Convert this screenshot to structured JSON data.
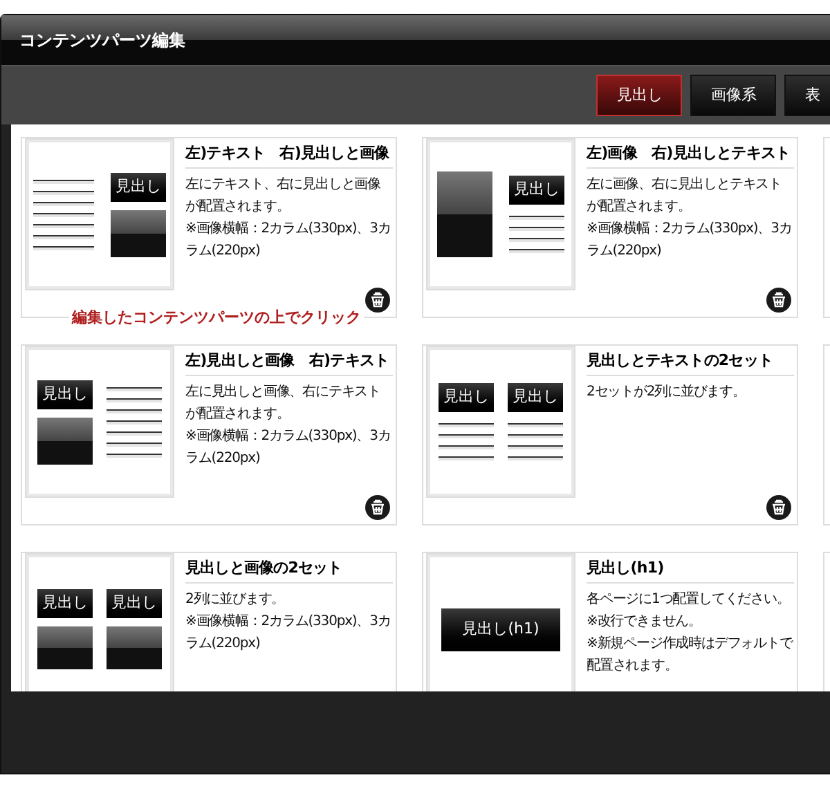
{
  "window": {
    "title": "コンテンツパーツ編集"
  },
  "tabs": [
    {
      "label": "見出し",
      "selected": true
    },
    {
      "label": "画像系",
      "selected": false
    },
    {
      "label": "表",
      "selected": false
    }
  ],
  "hint": "編集したコンテンツパーツの上でクリック",
  "cards": [
    {
      "kind": "text-heading-image",
      "labels": [
        "見出し"
      ],
      "title": "左)テキスト　右)見出しと画像",
      "description": [
        "左にテキスト、右に見出しと画像が配置されます。",
        "※画像横幅：2カラム(330px)、3カラム(220px)"
      ],
      "delete_icon": true
    },
    {
      "kind": "image-heading-text",
      "labels": [
        "見出し"
      ],
      "title": "左)画像　右)見出しとテキスト",
      "description": [
        "左に画像、右に見出しとテキストが配置されます。",
        "※画像横幅：2カラム(330px)、3カラム(220px)"
      ],
      "delete_icon": true
    },
    {
      "kind": "edge"
    },
    {
      "kind": "heading-image-text",
      "labels": [
        "見出し"
      ],
      "title": "左)見出しと画像　右)テキスト",
      "description": [
        "左に見出しと画像、右にテキストが配置されます。",
        "※画像横幅：2カラム(330px)、3カラム(220px)"
      ],
      "delete_icon": true
    },
    {
      "kind": "heading-text-pair",
      "labels": [
        "見出し",
        "見出し"
      ],
      "title": "見出しとテキストの2セット",
      "description": [
        "2セットが2列に並びます。"
      ],
      "delete_icon": true
    },
    {
      "kind": "edge"
    },
    {
      "kind": "heading-image-pair",
      "labels": [
        "見出し",
        "見出し"
      ],
      "title": "見出しと画像の2セット",
      "description": [
        "2列に並びます。",
        "※画像横幅：2カラム(330px)、3カラム(220px)"
      ],
      "delete_icon": false
    },
    {
      "kind": "heading-h1",
      "labels": [
        "見出し(h1)"
      ],
      "title": "見出し(h1)",
      "description": [
        "各ページに1つ配置してください。",
        "※改行できません。",
        "※新規ページ作成時はデフォルトで配置されます。"
      ],
      "delete_icon": false
    },
    {
      "kind": "edge"
    }
  ]
}
